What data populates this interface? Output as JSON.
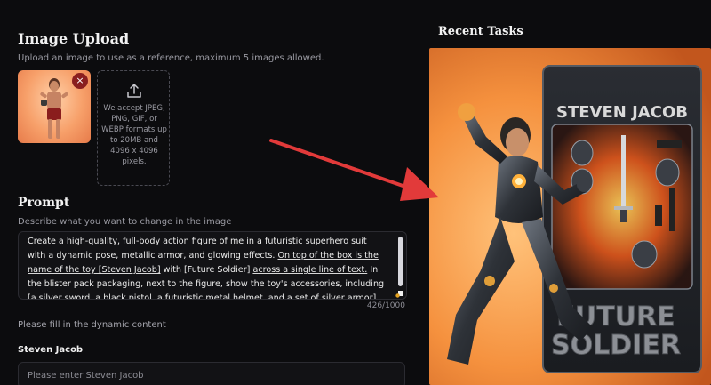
{
  "image_upload": {
    "title": "Image Upload",
    "subtitle": "Upload an image to use as a reference, maximum 5 images allowed.",
    "remove_icon": "×",
    "accept_text": "We accept JPEG, PNG, GIF, or WEBP formats up to 20MB and 4096 x 4096 pixels."
  },
  "prompt": {
    "title": "Prompt",
    "subtitle": "Describe what you want to change in the image",
    "text_a": "Create a high-quality, full-body action figure of me in a futuristic superhero suit with a dynamic pose, metallic armor, and glowing effects. ",
    "text_ul1": "On top of the box is the name of the toy [Steven Jacob]",
    "text_b": " with [Future Soldier] ",
    "text_ul2": "across a single line of text.",
    "text_c": " In the blister pack packaging, next to the figure, show the toy's accessories, including [a silver sword, a black pistol, a futuristic metal helmet, and a set of silver armor].",
    "counter": "426/1000"
  },
  "dynamic": {
    "label": "Please fill in the dynamic content",
    "field_label": "Steven Jacob",
    "field_placeholder": "Please enter Steven Jacob",
    "field_value": ""
  },
  "recent": {
    "title": "Recent Tasks",
    "box_name": "STEVEN JACOB",
    "box_line1": "FUTURE",
    "box_line2": "SOLDIER"
  },
  "colors": {
    "background": "#0c0c0e",
    "remove_button": "#8a1f1f",
    "arrow": "#e23a3a",
    "box_orange": "#f08a3c"
  },
  "icons": [
    "remove-icon",
    "upload-icon",
    "resize-handle-icon",
    "arrow-annotation"
  ]
}
